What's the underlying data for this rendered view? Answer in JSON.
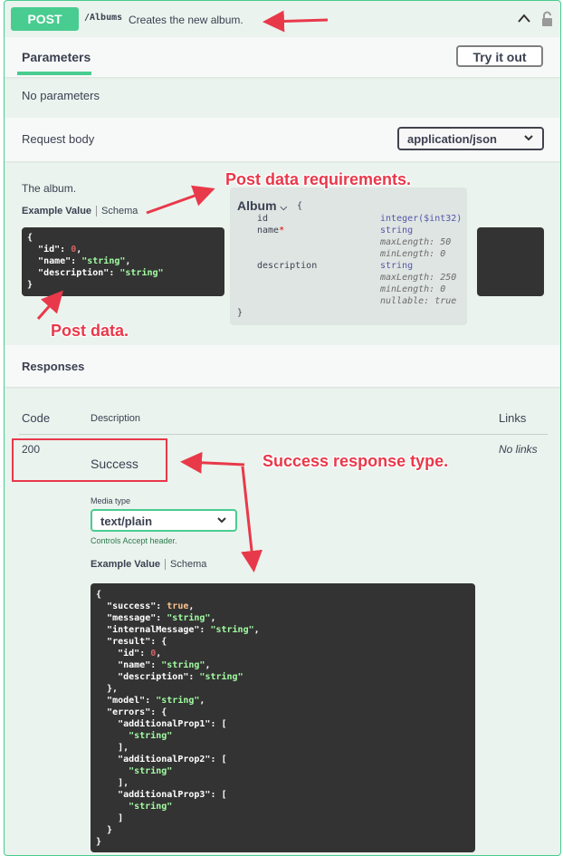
{
  "operation": {
    "method": "POST",
    "path": "/Albums",
    "summary": "Creates the new album."
  },
  "parameters": {
    "tab_label": "Parameters",
    "try_button": "Try it out",
    "empty_text": "No parameters"
  },
  "request_body": {
    "label": "Request body",
    "content_type": "application/json",
    "description": "The album.",
    "tab_example": "Example Value",
    "tab_schema": "Schema",
    "example_lines": [
      "{",
      "  \"id\": 0,",
      "  \"name\": \"string\",",
      "  \"description\": \"string\"",
      "}"
    ]
  },
  "schema": {
    "title": "Album",
    "open_brace": "{",
    "close_brace": "}",
    "fields": [
      {
        "name": "id",
        "required": false,
        "type": "integer($int32)",
        "constraints": []
      },
      {
        "name": "name",
        "required": true,
        "type": "string",
        "constraints": [
          "maxLength: 50",
          "minLength: 0"
        ]
      },
      {
        "name": "description",
        "required": false,
        "type": "string",
        "constraints": [
          "maxLength: 250",
          "minLength: 0",
          "nullable: true"
        ]
      }
    ]
  },
  "responses": {
    "title": "Responses",
    "col_code": "Code",
    "col_description": "Description",
    "col_links": "Links",
    "rows": [
      {
        "code": "200",
        "description": "Success",
        "links": "No links",
        "media_type_label": "Media type",
        "media_type": "text/plain",
        "controls_note": "Controls Accept header.",
        "tab_example": "Example Value",
        "tab_schema": "Schema"
      }
    ]
  },
  "annotations": {
    "post_data_requirements": "Post data requirements.",
    "post_data": "Post data.",
    "success_response_type": "Success response type."
  },
  "colors": {
    "post_green": "#49cc90",
    "annotation_red": "#e8394a",
    "code_bg": "#333333"
  }
}
